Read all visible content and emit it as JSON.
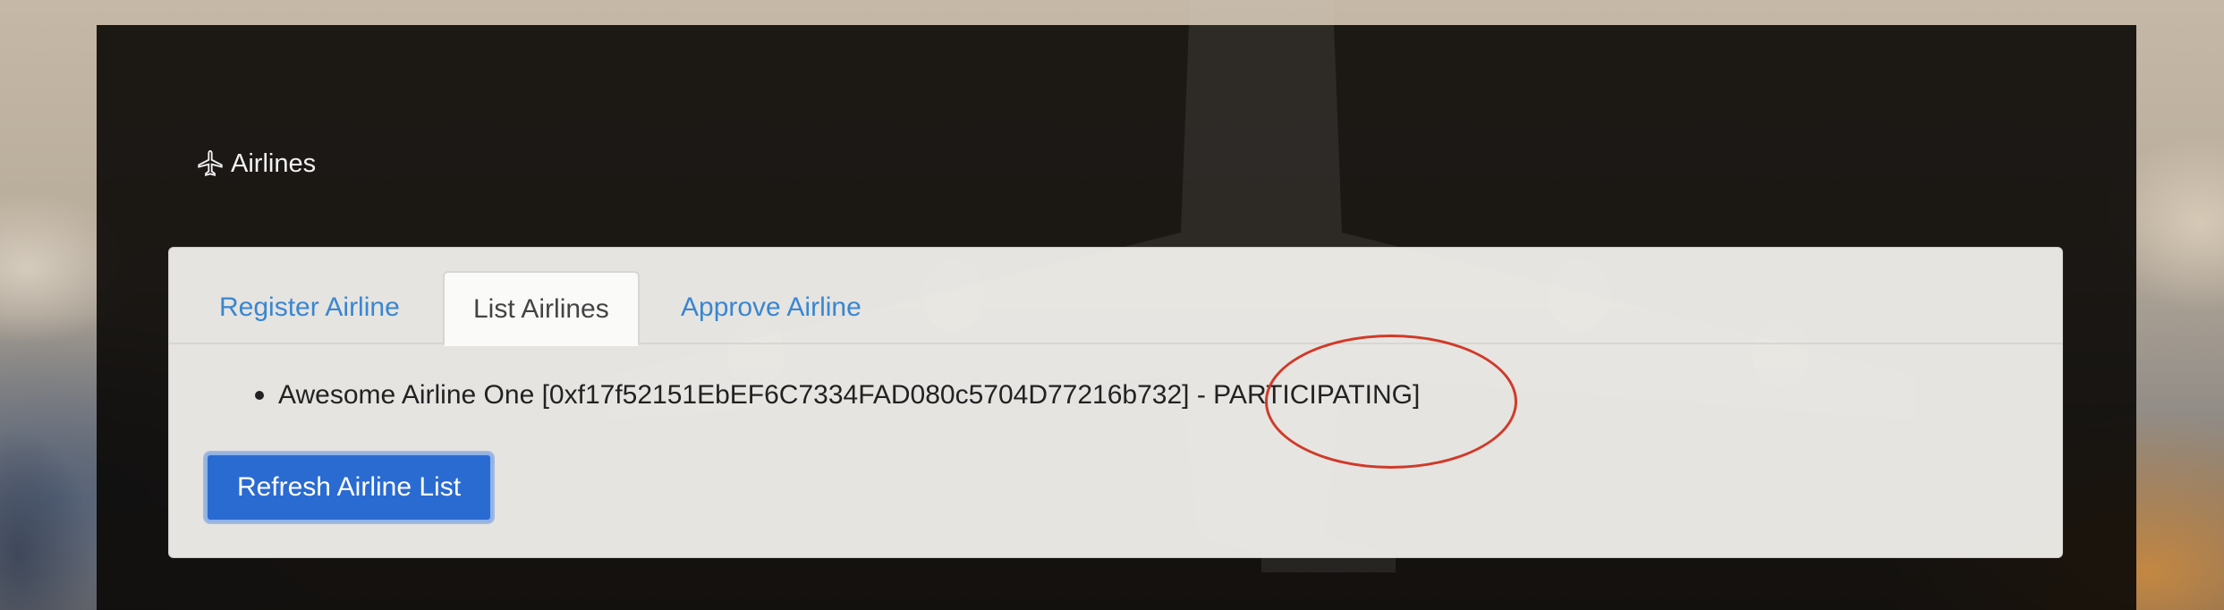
{
  "header": {
    "title": "Airlines",
    "icon": "airplane-icon"
  },
  "tabs": [
    {
      "label": "Register Airline",
      "active": false
    },
    {
      "label": "List Airlines",
      "active": true
    },
    {
      "label": "Approve Airline",
      "active": false
    }
  ],
  "airlines": [
    {
      "text": "Awesome Airline One [0xf17f52151EbEF6C7334FAD080c5704D77216b732] - PARTICIPATING]"
    }
  ],
  "actions": {
    "refresh_label": "Refresh Airline List"
  },
  "colors": {
    "link": "#3a86d0",
    "primary_button": "#2a6bd1",
    "annotation": "#d03a2a"
  }
}
